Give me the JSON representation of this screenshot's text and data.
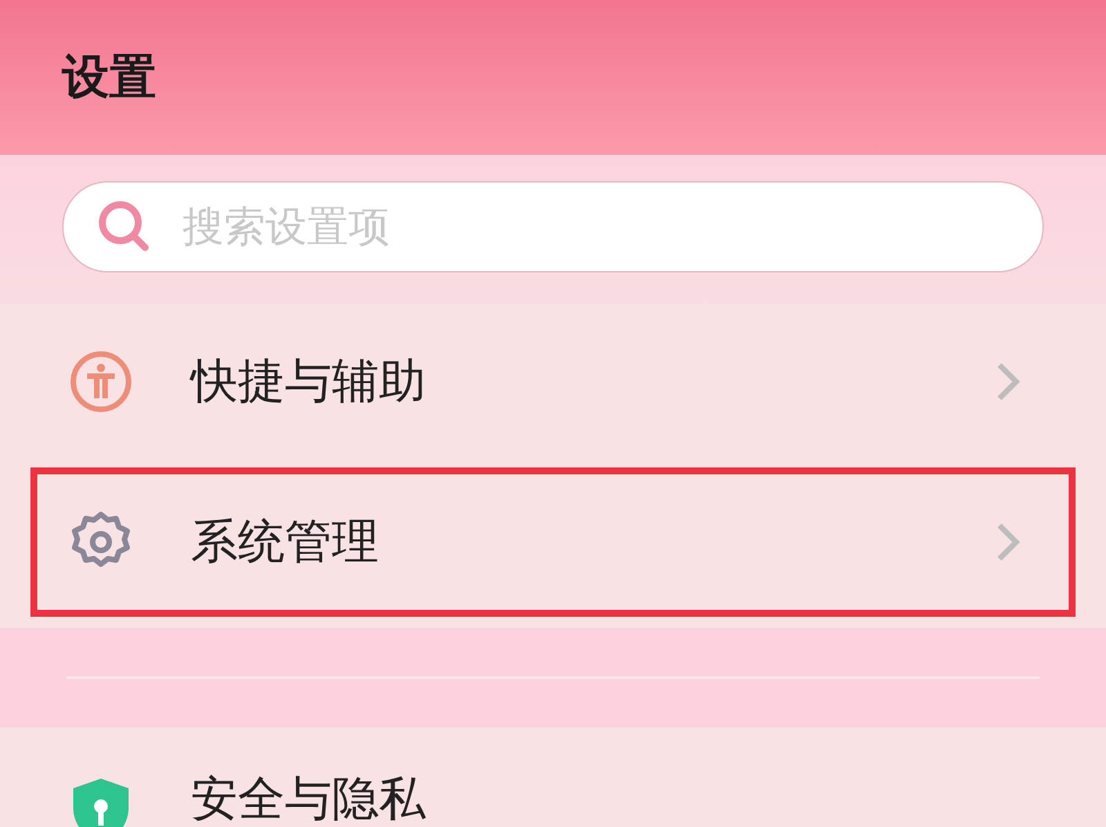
{
  "header": {
    "title": "设置"
  },
  "search": {
    "placeholder": "搜索设置项"
  },
  "items": [
    {
      "kind": "accessibility",
      "label": "快捷与辅助",
      "highlighted": false,
      "chevron": true
    },
    {
      "kind": "gear",
      "label": "系统管理",
      "highlighted": true,
      "chevron": true
    },
    {
      "kind": "shield",
      "label": "安全与隐私",
      "highlighted": false,
      "chevron": false
    }
  ]
}
